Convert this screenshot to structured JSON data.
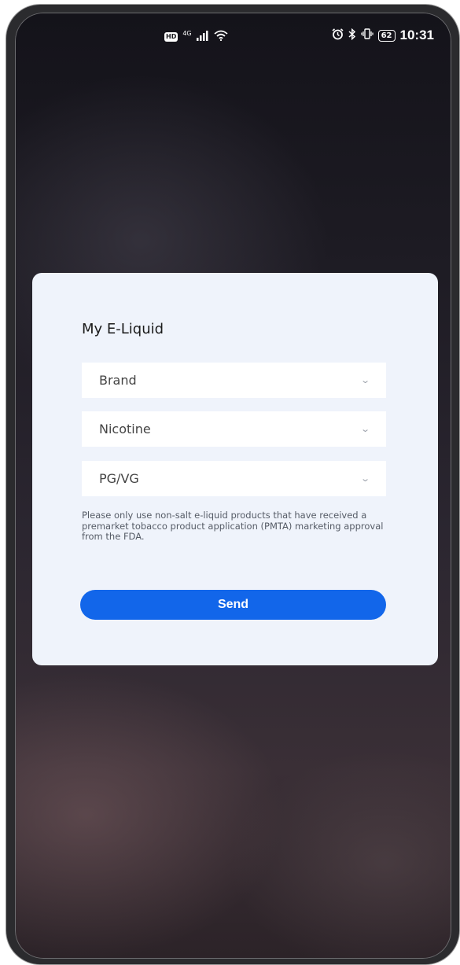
{
  "status_bar": {
    "badge": "HD",
    "network": "4G",
    "signal_icon": "signal-bars-icon",
    "wifi_icon": "wifi-icon",
    "alarm_icon": "alarm-icon",
    "bluetooth_icon": "bluetooth-icon",
    "vibrate_icon": "vibrate-icon",
    "battery": "62",
    "time": "10:31"
  },
  "card": {
    "title": "My E-Liquid",
    "selects": [
      {
        "label": "Brand"
      },
      {
        "label": "Nicotine"
      },
      {
        "label": "PG/VG"
      }
    ],
    "notice": "Please only use non-salt e-liquid products that have received a premarket tobacco product application (PMTA) marketing approval from the FDA.",
    "send_label": "Send"
  },
  "colors": {
    "accent": "#1266ea",
    "card_bg": "#eff3fb",
    "screen_bg": "#1d1b23"
  }
}
